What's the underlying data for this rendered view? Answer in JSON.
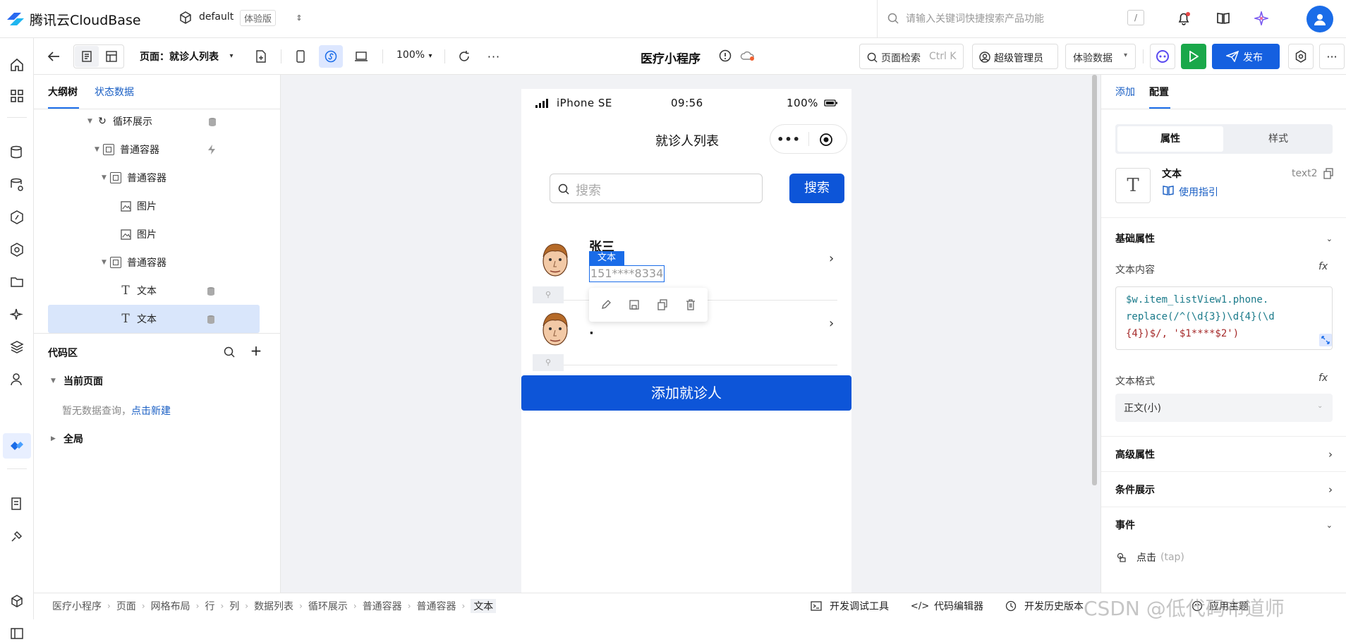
{
  "brand": {
    "name": "腾讯云CloudBase"
  },
  "env": {
    "name": "default",
    "badge": "体验版"
  },
  "search": {
    "placeholder": "请输入关键词快捷搜索产品功能",
    "shortcut": "/"
  },
  "toolbar": {
    "page_label": "页面：就诊人列表",
    "zoom": "100%",
    "app_title": "医疗小程序",
    "page_search": "页面检索",
    "page_search_shortcut": "Ctrl K",
    "role": "超级管理员",
    "data_mode": "体验数据",
    "publish": "发布"
  },
  "outline": {
    "tabs": [
      "大纲树",
      "状态数据"
    ],
    "nodes": [
      {
        "label": "循环展示"
      },
      {
        "label": "普通容器"
      },
      {
        "label": "普通容器"
      },
      {
        "label": "图片"
      },
      {
        "label": "图片"
      },
      {
        "label": "普通容器"
      },
      {
        "label": "文本"
      },
      {
        "label": "文本"
      }
    ],
    "code_title": "代码区",
    "current_page": "当前页面",
    "empty_prefix": "暂无数据查询，",
    "empty_link": "点击新建",
    "global": "全局"
  },
  "phone": {
    "device": "iPhone SE",
    "time": "09:56",
    "battery": "100%",
    "nav_title": "就诊人列表",
    "search_placeholder": "搜索",
    "search_button": "搜索",
    "patients": [
      {
        "name": "张三",
        "phone": "151****8334"
      },
      {
        "name": "·",
        "phone": ""
      }
    ],
    "selection_tag": "文本",
    "add_button": "添加就诊人"
  },
  "rightpanel": {
    "tabs": [
      "添加",
      "配置"
    ],
    "seg": [
      "属性",
      "样式"
    ],
    "component_name": "文本",
    "component_id": "text2",
    "guide": "使用指引",
    "basic": "基础属性",
    "text_content_label": "文本内容",
    "fx": "fx",
    "code_line1": "$w.item_listView1.phone.",
    "code_line2": "replace(/^(\\d{3})\\d{4}(\\d",
    "code_line3": "{4})$/, '$1****$2')",
    "text_format_label": "文本格式",
    "text_format_value": "正文(小)",
    "advanced": "高级属性",
    "conditional": "条件展示",
    "events": "事件",
    "event_tap": "点击",
    "event_tap_code": "(tap)"
  },
  "statusbar": {
    "crumbs": [
      "医疗小程序",
      "页面",
      "网格布局",
      "行",
      "列",
      "数据列表",
      "循环展示",
      "普通容器",
      "普通容器",
      "文本"
    ],
    "dev_tools": "开发调试工具",
    "code_editor": "代码编辑器",
    "history": "开发历史版本",
    "theme": "应用主题",
    "watermark": "CSDN @低代码布道师"
  }
}
